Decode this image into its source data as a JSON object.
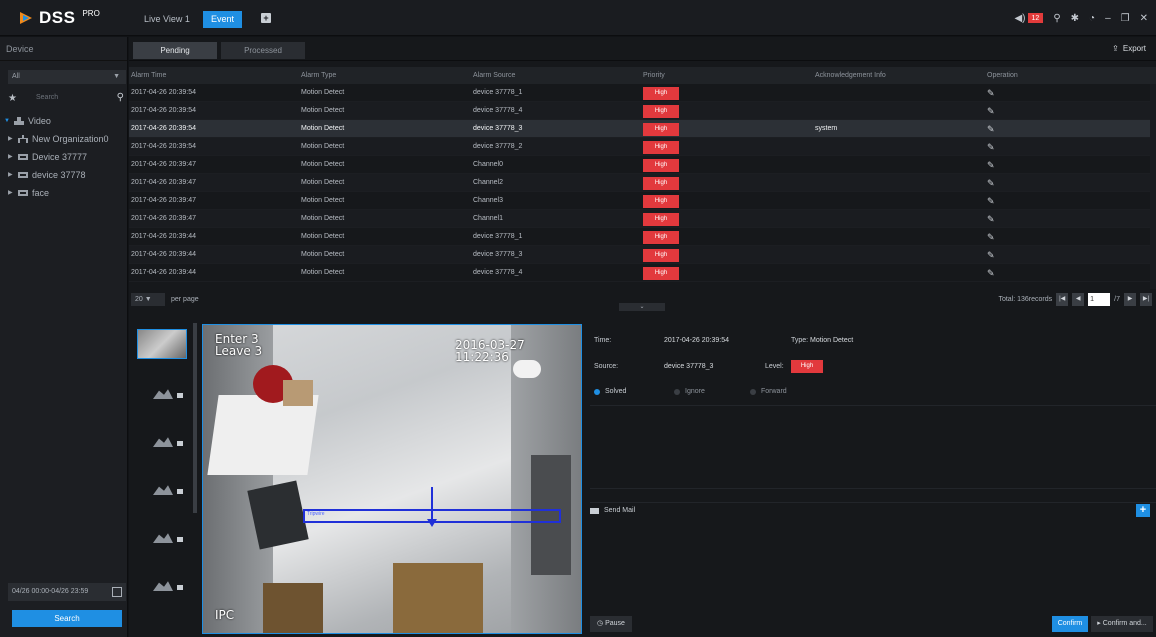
{
  "app": {
    "logo_text": "DSS",
    "logo_sup": "PRO",
    "tabs": [
      {
        "label": "Live View 1",
        "active": false
      },
      {
        "label": "Event",
        "active": true
      }
    ],
    "add_tab_icon": "plus-icon",
    "alarm_count": "12",
    "accent_color": "#1f8fe3",
    "alert_color": "#e2393d"
  },
  "sidebar": {
    "title": "Device",
    "filter_value": "All",
    "search_placeholder": "Search",
    "tree": [
      {
        "label": "Video",
        "level": 0,
        "expanded": true,
        "icon": "video-org-icon"
      },
      {
        "label": "New Organization0",
        "level": 1,
        "icon": "organization-icon"
      },
      {
        "label": "Device 37777",
        "level": 1,
        "icon": "device-icon"
      },
      {
        "label": "device 37778",
        "level": 1,
        "icon": "device-icon"
      },
      {
        "label": "face",
        "level": 1,
        "icon": "device-icon"
      }
    ],
    "date_range": "04/26 00:00-04/26 23:59",
    "search_button": "Search"
  },
  "main": {
    "subtabs": [
      {
        "label": "Pending",
        "active": true
      },
      {
        "label": "Processed",
        "active": false
      }
    ],
    "export_label": "Export",
    "columns": [
      "Alarm Time",
      "Alarm Type",
      "Alarm Source",
      "Priority",
      "Acknowledgement Info",
      "Operation"
    ],
    "rows": [
      {
        "time": "2017-04-26 20:39:54",
        "type": "Motion Detect",
        "source": "device 37778_1",
        "priority": "High",
        "ack": ""
      },
      {
        "time": "2017-04-26 20:39:54",
        "type": "Motion Detect",
        "source": "device 37778_4",
        "priority": "High",
        "ack": ""
      },
      {
        "time": "2017-04-26 20:39:54",
        "type": "Motion Detect",
        "source": "device 37778_3",
        "priority": "High",
        "ack": "system"
      },
      {
        "time": "2017-04-26 20:39:54",
        "type": "Motion Detect",
        "source": "device 37778_2",
        "priority": "High",
        "ack": ""
      },
      {
        "time": "2017-04-26 20:39:47",
        "type": "Motion Detect",
        "source": "Channel0",
        "priority": "High",
        "ack": ""
      },
      {
        "time": "2017-04-26 20:39:47",
        "type": "Motion Detect",
        "source": "Channel2",
        "priority": "High",
        "ack": ""
      },
      {
        "time": "2017-04-26 20:39:47",
        "type": "Motion Detect",
        "source": "Channel3",
        "priority": "High",
        "ack": ""
      },
      {
        "time": "2017-04-26 20:39:47",
        "type": "Motion Detect",
        "source": "Channel1",
        "priority": "High",
        "ack": ""
      },
      {
        "time": "2017-04-26 20:39:44",
        "type": "Motion Detect",
        "source": "device 37778_1",
        "priority": "High",
        "ack": ""
      },
      {
        "time": "2017-04-26 20:39:44",
        "type": "Motion Detect",
        "source": "device 37778_3",
        "priority": "High",
        "ack": ""
      },
      {
        "time": "2017-04-26 20:39:44",
        "type": "Motion Detect",
        "source": "device 37778_4",
        "priority": "High",
        "ack": ""
      }
    ],
    "selected_row": 2,
    "per_page": "20",
    "per_page_label": "per page",
    "total_label": "Total: 136records",
    "current_page": "1",
    "total_pages": "/7"
  },
  "video": {
    "overlay_line1": "Enter 3",
    "overlay_line2": "Leave 3",
    "timestamp": "2016-03-27 11:22:36",
    "rule_label": "Tripwire",
    "channel_label": "IPC"
  },
  "detail": {
    "time_label": "Time:",
    "time_value": "2017-04-26 20:39:54",
    "type_label": "Type:",
    "type_value": "Motion Detect",
    "source_label": "Source:",
    "source_value": "device 37778_3",
    "level_label": "Level:",
    "level_value": "High",
    "options": [
      {
        "label": "Solved",
        "selected": true
      },
      {
        "label": "Ignore",
        "selected": false
      },
      {
        "label": "Forward",
        "selected": false
      }
    ],
    "send_mail_label": "Send Mail",
    "pause_label": "Pause",
    "confirm_label": "Confirm",
    "confirm_and_label": "Confirm and..."
  }
}
